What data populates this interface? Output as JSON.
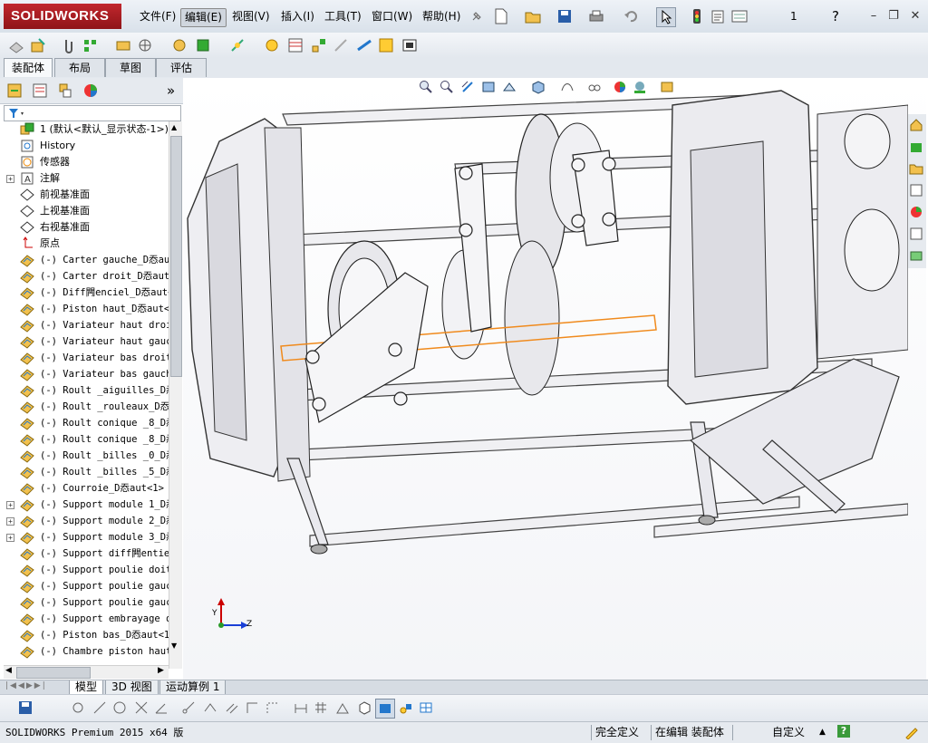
{
  "app": {
    "logo_text": "SOLIDWORKS",
    "brand_color": "#b01e23",
    "menu": [
      {
        "label": "文件(F)",
        "active": false
      },
      {
        "label": "编辑(E)",
        "active": true
      },
      {
        "label": "视图(V)",
        "active": false
      },
      {
        "label": "插入(I)",
        "active": false
      },
      {
        "label": "工具(T)",
        "active": false
      },
      {
        "label": "窗口(W)",
        "active": false
      },
      {
        "label": "帮助(H)",
        "active": false
      }
    ],
    "doc_number": "1",
    "help_icon": "?"
  },
  "command_tabs": [
    {
      "label": "装配体",
      "active": true
    },
    {
      "label": "布局",
      "active": false
    },
    {
      "label": "草图",
      "active": false
    },
    {
      "label": "评估",
      "active": false
    }
  ],
  "feature_manager": {
    "collapse_label": "»",
    "tree": [
      {
        "label": "1  (默认<默认_显示状态-1>)",
        "icon": "assembly-icon",
        "expander": "",
        "font": "sans"
      },
      {
        "label": "History",
        "icon": "history-icon",
        "expander": "",
        "font": "sans"
      },
      {
        "label": "传感器",
        "icon": "sensor-icon",
        "expander": "",
        "font": "sans"
      },
      {
        "label": "注解",
        "icon": "annotation-icon",
        "expander": "+",
        "font": "sans"
      },
      {
        "label": "前视基准面",
        "icon": "plane-icon",
        "expander": "",
        "font": "sans"
      },
      {
        "label": "上视基准面",
        "icon": "plane-icon",
        "expander": "",
        "font": "sans"
      },
      {
        "label": "右视基准面",
        "icon": "plane-icon",
        "expander": "",
        "font": "sans"
      },
      {
        "label": "原点",
        "icon": "origin-icon",
        "expander": "",
        "font": "sans"
      },
      {
        "label": "(-) Carter gauche_D㤁aut",
        "icon": "part-icon",
        "expander": "",
        "font": "mono"
      },
      {
        "label": "(-) Carter droit_D㤁aut<",
        "icon": "part-icon",
        "expander": "",
        "font": "mono"
      },
      {
        "label": "(-) Diff闁enciel_D㤁aut<",
        "icon": "part-icon",
        "expander": "",
        "font": "mono"
      },
      {
        "label": "(-) Piston haut_D㤁aut<1",
        "icon": "part-icon",
        "expander": "",
        "font": "mono"
      },
      {
        "label": "(-) Variateur haut droit",
        "icon": "part-icon",
        "expander": "",
        "font": "mono"
      },
      {
        "label": "(-) Variateur haut gauch",
        "icon": "part-icon",
        "expander": "",
        "font": "mono"
      },
      {
        "label": "(-) Variateur bas droit_",
        "icon": "part-icon",
        "expander": "",
        "font": "mono"
      },
      {
        "label": "(-) Variateur bas gauche",
        "icon": "part-icon",
        "expander": "",
        "font": "mono"
      },
      {
        "label": "(-) Roult _aiguilles_D㤁",
        "icon": "part-icon",
        "expander": "",
        "font": "mono"
      },
      {
        "label": "(-) Roult _rouleaux_D㤁a",
        "icon": "part-icon",
        "expander": "",
        "font": "mono"
      },
      {
        "label": "(-) Roult conique _8_D㤁",
        "icon": "part-icon",
        "expander": "",
        "font": "mono"
      },
      {
        "label": "(-) Roult conique _8_D㤁",
        "icon": "part-icon",
        "expander": "",
        "font": "mono"
      },
      {
        "label": "(-) Roult _billes _0_D㤁",
        "icon": "part-icon",
        "expander": "",
        "font": "mono"
      },
      {
        "label": "(-) Roult _billes _5_D㤁",
        "icon": "part-icon",
        "expander": "",
        "font": "mono"
      },
      {
        "label": "(-) Courroie_D㤁aut<1> (",
        "icon": "part-icon",
        "expander": "",
        "font": "mono"
      },
      {
        "label": "(-) Support module 1_D㤁",
        "icon": "part-icon",
        "expander": "+",
        "font": "mono"
      },
      {
        "label": "(-) Support module 2_D㤁",
        "icon": "part-icon",
        "expander": "+",
        "font": "mono"
      },
      {
        "label": "(-) Support module 3_D㤁",
        "icon": "part-icon",
        "expander": "+",
        "font": "mono"
      },
      {
        "label": "(-) Support diff闁entiel",
        "icon": "part-icon",
        "expander": "",
        "font": "mono"
      },
      {
        "label": "(-) Support poulie doit_",
        "icon": "part-icon",
        "expander": "",
        "font": "mono"
      },
      {
        "label": "(-) Support poulie gauch",
        "icon": "part-icon",
        "expander": "",
        "font": "mono"
      },
      {
        "label": "(-) Support poulie gauch",
        "icon": "part-icon",
        "expander": "",
        "font": "mono"
      },
      {
        "label": "(-) Support embrayage dr",
        "icon": "part-icon",
        "expander": "",
        "font": "mono"
      },
      {
        "label": "(-) Piston bas_D㤁aut<1>",
        "icon": "part-icon",
        "expander": "",
        "font": "mono"
      },
      {
        "label": "(-) Chambre piston haut_",
        "icon": "part-icon",
        "expander": "",
        "font": "mono"
      }
    ]
  },
  "graphics": {
    "triad_x_label": "Z",
    "triad_y_label": "Y"
  },
  "bottom_tabs": [
    {
      "label": "模型",
      "active": true
    },
    {
      "label": "3D 视图",
      "active": false
    },
    {
      "label": "运动算例 1",
      "active": false
    }
  ],
  "status": {
    "product": "SOLIDWORKS Premium 2015 x64 版",
    "definition": "完全定义",
    "editing": "在编辑 装配体",
    "units": "自定义",
    "arrow": "▲",
    "help": "?"
  }
}
